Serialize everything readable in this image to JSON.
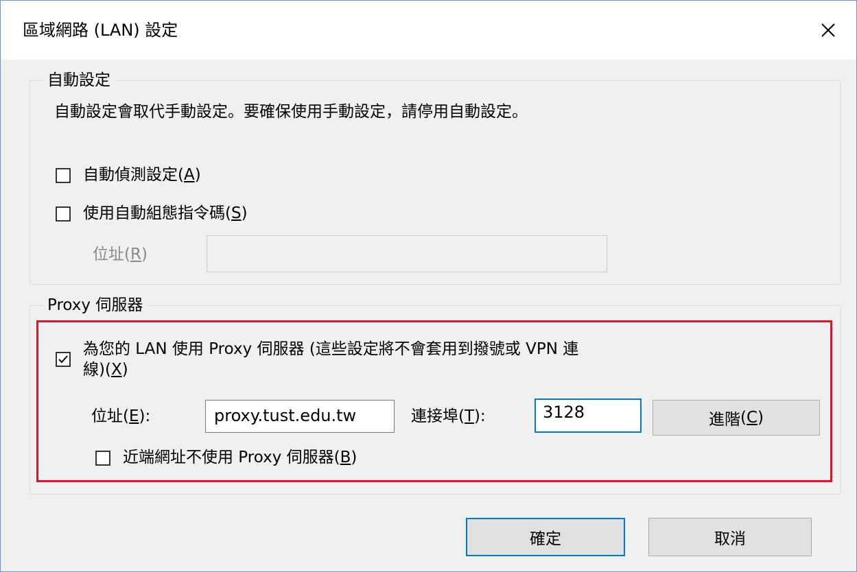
{
  "window": {
    "title": "區域網路 (LAN) 設定",
    "close_icon": "close-icon"
  },
  "auto_config": {
    "group_title": "自動設定",
    "description": "自動設定會取代手動設定。要確保使用手動設定，請停用自動設定。",
    "auto_detect": {
      "label": "自動偵測設定",
      "accel": "A",
      "checked": false
    },
    "use_script": {
      "label": "使用自動組態指令碼",
      "accel": "S",
      "checked": false
    },
    "address": {
      "label": "位址",
      "accel": "R",
      "value": "",
      "enabled": false
    }
  },
  "proxy": {
    "group_title": "Proxy 伺服器",
    "use_proxy": {
      "label_line1": "為您的 LAN 使用 Proxy 伺服器 (這些設定將不會套用到撥號或 VPN 連",
      "label_line2": "線)",
      "accel": "X",
      "checked": true
    },
    "address": {
      "label": "位址",
      "accel": "E",
      "value": "proxy.tust.edu.tw"
    },
    "port": {
      "label": "連接埠",
      "accel": "T",
      "value": "3128"
    },
    "advanced_button": {
      "label": "進階",
      "accel": "C"
    },
    "bypass_local": {
      "label": "近端網址不使用 Proxy 伺服器",
      "accel": "B",
      "checked": false
    }
  },
  "buttons": {
    "ok": "確定",
    "cancel": "取消"
  },
  "colors": {
    "highlight": "#e81123",
    "focus": "#0078d7",
    "dialog_bg": "#f0f0f0"
  }
}
